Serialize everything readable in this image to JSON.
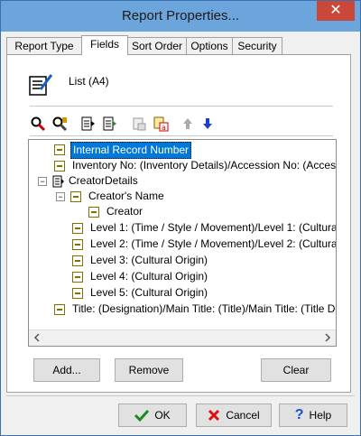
{
  "window": {
    "title": "Report Properties...",
    "close_glyph": "✕"
  },
  "tabs": [
    {
      "label": "Report Type"
    },
    {
      "label": "Fields"
    },
    {
      "label": "Sort Order"
    },
    {
      "label": "Options"
    },
    {
      "label": "Security"
    }
  ],
  "format": {
    "icon": "document-pen-icon",
    "label": "List (A4)"
  },
  "toolbar": {
    "buttons": [
      "find-icon",
      "find-next-icon",
      "field-list-icon",
      "add-list-icon",
      "cut-icon",
      "paste-icon",
      "move-up-icon",
      "move-down-icon"
    ]
  },
  "tree": {
    "rows": [
      {
        "text": "Internal Record Number",
        "selected": true
      },
      {
        "text": "Inventory No: (Inventory Details)/Accession No: (Access"
      },
      {
        "text": "CreatorDetails"
      },
      {
        "text": "Creator's Name"
      },
      {
        "text": "Creator"
      },
      {
        "text": "Level 1: (Time / Style / Movement)/Level 1: (Cultura"
      },
      {
        "text": "Level 2: (Time / Style / Movement)/Level 2: (Cultura"
      },
      {
        "text": "Level 3: (Cultural Origin)"
      },
      {
        "text": "Level 4: (Cultural Origin)"
      },
      {
        "text": "Level 5: (Cultural Origin)"
      },
      {
        "text": "Title: (Designation)/Main Title: (Title)/Main Title: (Title De"
      }
    ],
    "expand_minus": "−"
  },
  "buttons": {
    "add": "Add...",
    "remove": "Remove",
    "clear": "Clear",
    "ok": "OK",
    "cancel": "Cancel",
    "help": "Help"
  },
  "colors": {
    "selection": "#0078d7",
    "title_bar": "#6ba5dc",
    "field_icon": "#807000"
  }
}
